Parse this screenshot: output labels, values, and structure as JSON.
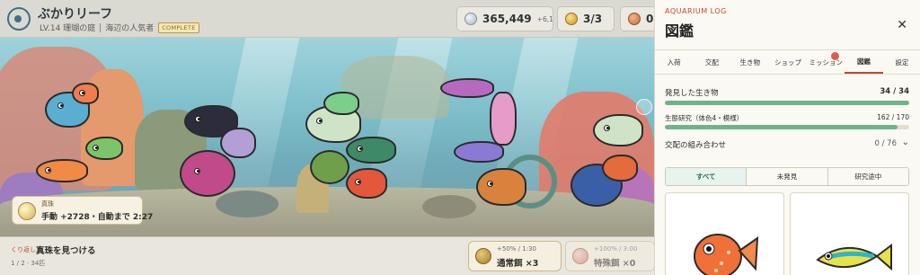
{
  "header": {
    "title": "ぶかりリーフ",
    "level": "LV.14 珊瑚の庭",
    "rank": "海辺の人気者",
    "complete_badge": "COMPLETE"
  },
  "counters": {
    "coins": {
      "value": "365,449",
      "rate": "+6,137/分",
      "icon": "silver-coin-icon"
    },
    "gold": {
      "value": "3/3",
      "icon": "gold-coin-icon"
    },
    "gems": {
      "value": "0",
      "icon": "gem-icon"
    }
  },
  "pearl": {
    "label": "真珠",
    "value": "手動 +2728・自動まで 2:27"
  },
  "quest": {
    "label": "くり返し7",
    "title": "真珠を見つける",
    "progress": "1 / 2 · 34匹"
  },
  "feeds": [
    {
      "rate": "+50% / 1:30",
      "name": "通常餌 ×3"
    },
    {
      "rate": "+100% / 3:00",
      "name": "特殊餌 ×0"
    }
  ],
  "panel": {
    "kicker": "AQUARIUM LOG",
    "title": "図鑑",
    "close_icon": "close-icon",
    "tabs": [
      "入荷",
      "交配",
      "生き物",
      "ショップ",
      "ミッション",
      "図鑑",
      "設定"
    ],
    "active_tab": 5,
    "discovered": {
      "label": "発見した生き物",
      "value": "34 / 34",
      "fraction": 1.0
    },
    "research": {
      "label": "生態研究（体色4・模様）",
      "value": "162 / 170",
      "fraction": 0.953
    },
    "combos": {
      "label": "交配の組み合わせ",
      "value": "0 / 76"
    },
    "filters": [
      "すべて",
      "未発見",
      "研究途中"
    ],
    "active_filter": 0
  },
  "colors": {
    "accent": "#c0492f",
    "progress": "#6fb38a",
    "teal": "#2c6a57"
  }
}
